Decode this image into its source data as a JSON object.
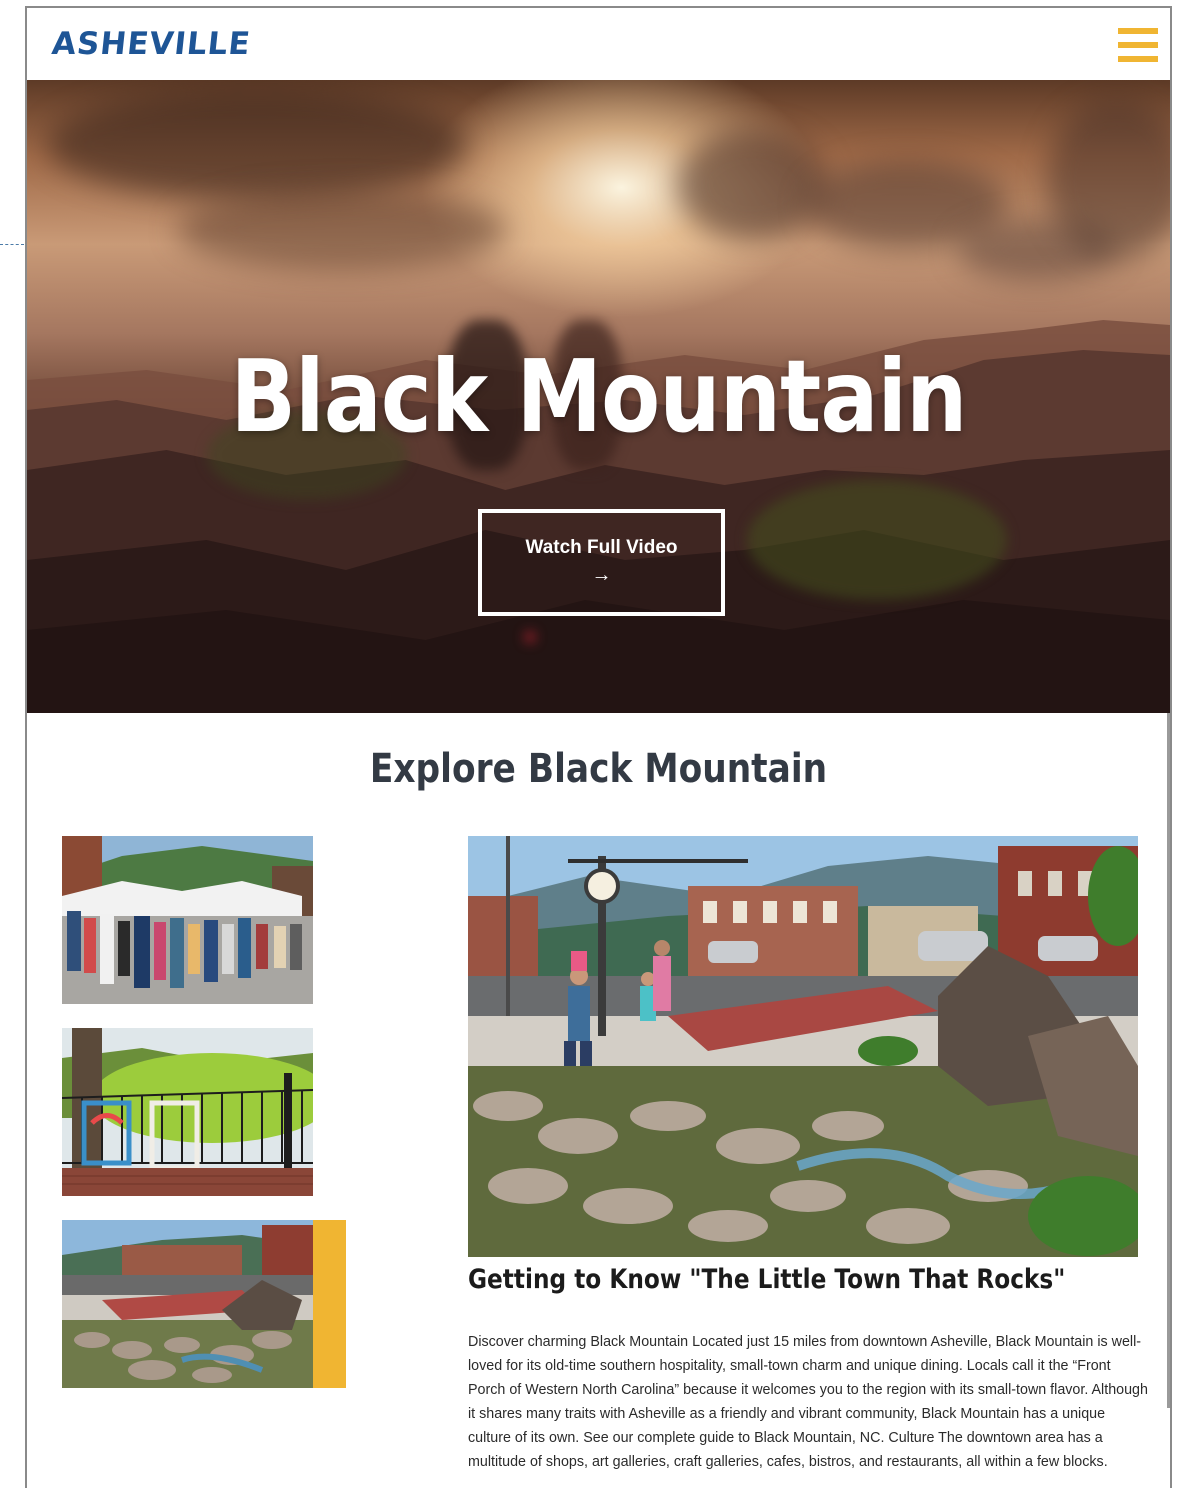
{
  "header": {
    "logo_text": "ASHEVILLE",
    "menu_icon": "hamburger-menu-icon"
  },
  "hero": {
    "title": "Black Mountain",
    "video_button_label": "Watch Full Video",
    "video_button_arrow": "→",
    "arrow_icon": "arrow-right-icon"
  },
  "explore": {
    "title": "Explore Black Mountain",
    "thumbnails": [
      {
        "name": "street-market-photo",
        "selected": false
      },
      {
        "name": "rocking-chairs-photo",
        "selected": false
      },
      {
        "name": "downtown-creek-photo",
        "selected": true
      }
    ],
    "feature": {
      "title": "Getting to Know \"The Little Town That Rocks\"",
      "body": "Discover charming Black Mountain Located just 15 miles from downtown Asheville, Black Mountain is well-loved for its old-time southern hospitality, small-town charm and unique dining. Locals call it the “Front Porch of Western North Carolina” because it welcomes you to the region with its small-town flavor. Although it shares many traits with Asheville as a friendly and vibrant community, Black Mountain has a unique culture of its own. See our complete guide to Black Mountain, NC. Culture The downtown area has a multitude of shops, art galleries, craft galleries, cafes, bistros, and restaurants, all within a few blocks."
    }
  },
  "colors": {
    "brand_blue": "#1e5596",
    "accent_gold": "#f0b532",
    "heading_dark": "#333a44"
  }
}
